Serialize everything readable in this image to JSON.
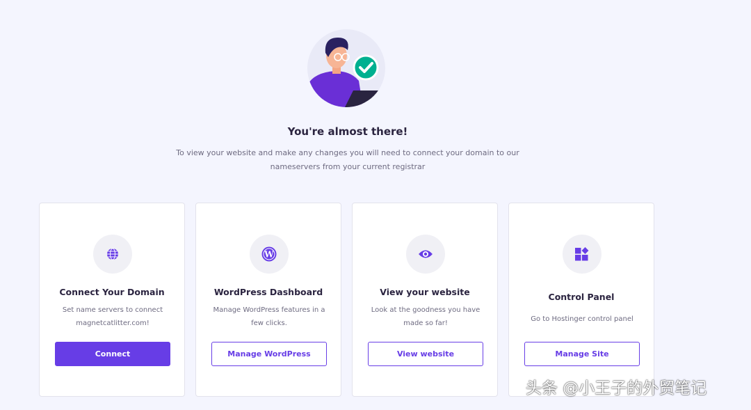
{
  "hero": {
    "title": "You're almost there!",
    "subtitle": "To view your website and make any changes you will need to connect your domain to our nameservers from your current registrar",
    "illustration_icon": "person-with-checkmark-illustration"
  },
  "cards": [
    {
      "icon": "globe-icon",
      "title": "Connect Your Domain",
      "description": "Set name servers to connect magnetcatlitter.com!",
      "button_label": "Connect",
      "button_style": "primary"
    },
    {
      "icon": "wordpress-icon",
      "title": "WordPress Dashboard",
      "description": "Manage WordPress features in a few clicks.",
      "button_label": "Manage WordPress",
      "button_style": "outline"
    },
    {
      "icon": "eye-icon",
      "title": "View your website",
      "description": "Look at the goodness you have made so far!",
      "button_label": "View website",
      "button_style": "outline"
    },
    {
      "icon": "control-panel-icon",
      "title": "Control Panel",
      "description": "Go to Hostinger control panel",
      "button_label": "Manage Site",
      "button_style": "outline"
    }
  ],
  "colors": {
    "background": "#f4f5fe",
    "accent": "#673de6",
    "success": "#00b090"
  },
  "watermark": "头条 @小王子的外贸笔记"
}
